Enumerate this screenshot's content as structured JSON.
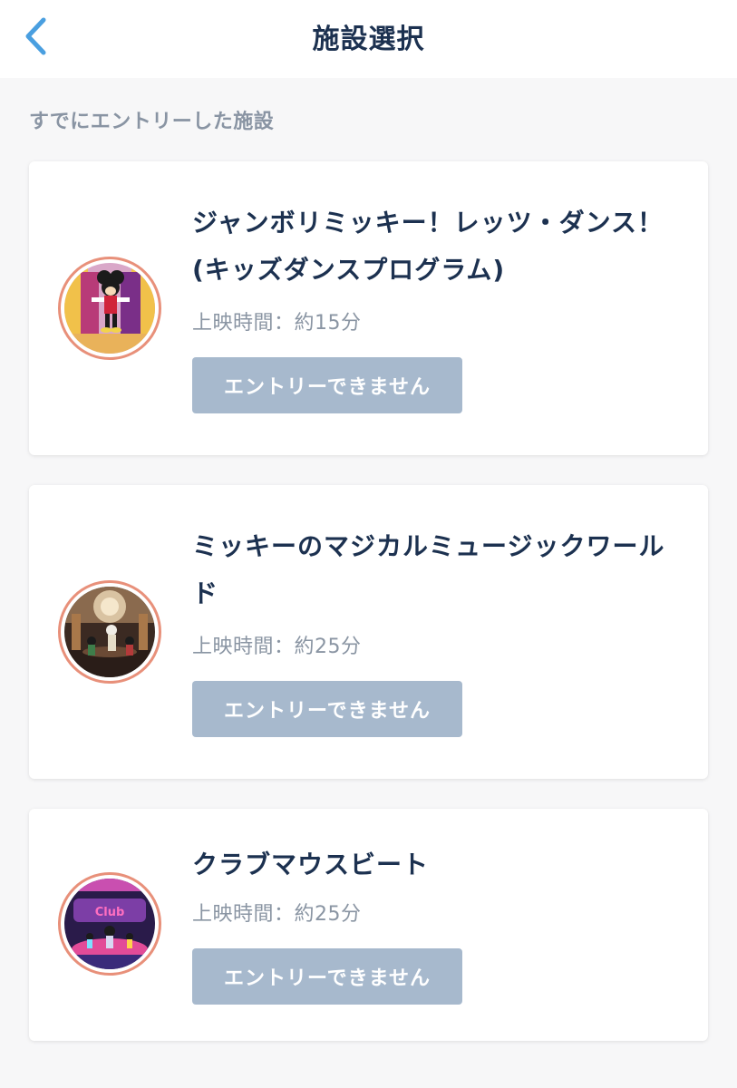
{
  "header": {
    "title": "施設選択",
    "back_icon": "chevron-left-icon"
  },
  "section": {
    "label": "すでにエントリーした施設"
  },
  "colors": {
    "accent": "#4a9fe0",
    "title_text": "#1c3150",
    "muted_text": "#8994a3",
    "button_disabled": "#a7b9cd",
    "thumb_ring": "#e8907a"
  },
  "facilities": [
    {
      "title": "ジャンボリミッキー！レッツ・ダンス！(キッズダンスプログラム)",
      "duration": "上映時間：約15分",
      "button_label": "エントリーできません",
      "image": "mickey-show-thumbnail"
    },
    {
      "title": "ミッキーのマジカルミュージックワールド",
      "duration": "上映時間：約25分",
      "button_label": "エントリーできません",
      "image": "magical-music-world-thumbnail"
    },
    {
      "title": "クラブマウスビート",
      "duration": "上映時間：約25分",
      "button_label": "エントリーできません",
      "image": "club-mouse-beat-thumbnail"
    }
  ]
}
